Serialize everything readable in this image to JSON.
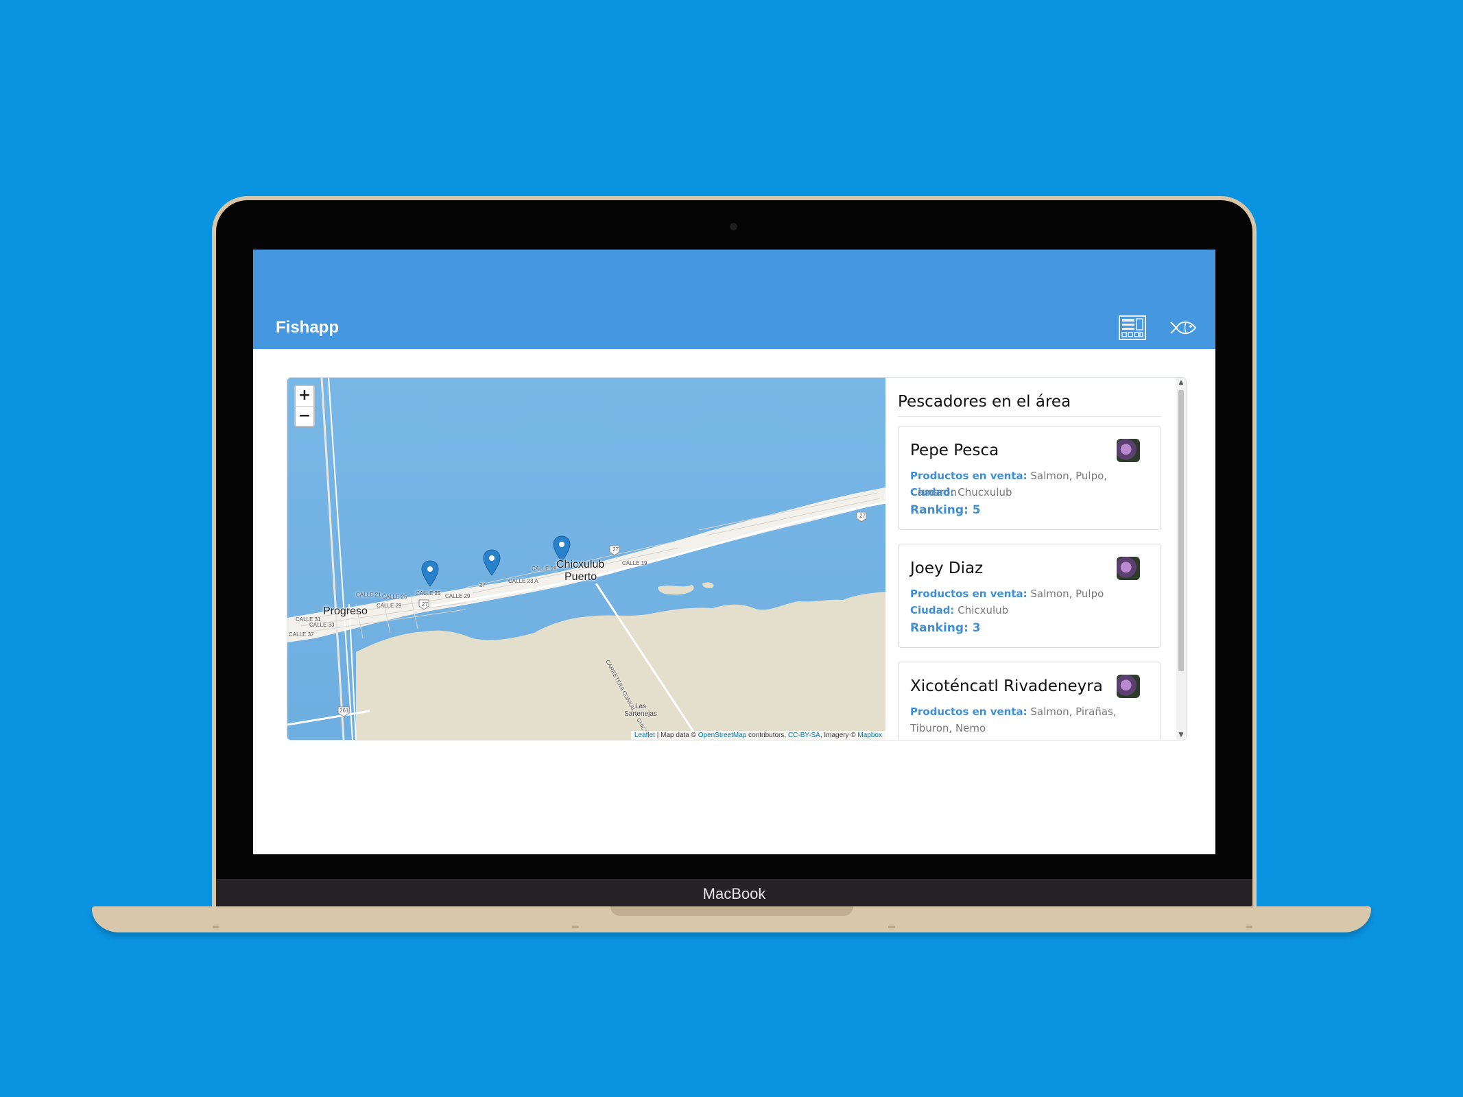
{
  "device": {
    "brand_label": "MacBook"
  },
  "app": {
    "title": "Fishapp"
  },
  "map": {
    "zoom_in": "+",
    "zoom_out": "−",
    "labels": {
      "progreso": "Progreso",
      "chicxulub_1": "Chicxulub",
      "chicxulub_2": "Puerto",
      "calle_21": "CALLE 21",
      "calle_25a": "CALLE 25",
      "calle_25b": "CALLE 25",
      "calle_29a": "CALLE 29",
      "calle_29b": "CALLE 29",
      "calle_31": "CALLE 31",
      "calle_33": "CALLE 33",
      "calle_37": "CALLE 37",
      "calle_23a": "CALLE 23 A",
      "calle_19a": "CALLE 19",
      "calle_19b": "CALLE 19",
      "street_27": "27",
      "road_27a": "27",
      "road_27b": "27",
      "road_27c": "27",
      "road_261": "261",
      "carretera": "CARRETERA CONKAL — CHICXULUB PUERT",
      "las_sartenejas": "Las Sartenejas"
    },
    "attribution": {
      "leaflet": "Leaflet",
      "sep1": " | Map data © ",
      "osm": "OpenStreetMap",
      "contributors": " contributors, ",
      "license": "CC-BY-SA",
      "imagery": ", Imagery © ",
      "mapbox": "Mapbox"
    },
    "colors": {
      "water": "#74b4e4",
      "land": "#e6e0d0",
      "urban": "#f3f1ec",
      "marker": "#2a81cb"
    }
  },
  "panel": {
    "heading": "Pescadores en el área",
    "products_label": "Productos en venta:",
    "city_label": "Ciudad:",
    "ranking_label": "Ranking:",
    "fishers": [
      {
        "name": "Pepe Pesca",
        "products": "Salmon, Pulpo, Camarón",
        "city": "Chucxulub",
        "ranking": "5"
      },
      {
        "name": "Joey Diaz",
        "products": "Salmon, Pulpo",
        "city": "Chicxulub",
        "ranking": "3"
      },
      {
        "name": "Xicoténcatl Rivadeneyra",
        "products": "Salmon, Pirañas, Tiburon, Nemo"
      }
    ]
  },
  "icons": {
    "list_view": "list-view-icon",
    "fish": "fish-icon",
    "avatar": "avatar"
  }
}
